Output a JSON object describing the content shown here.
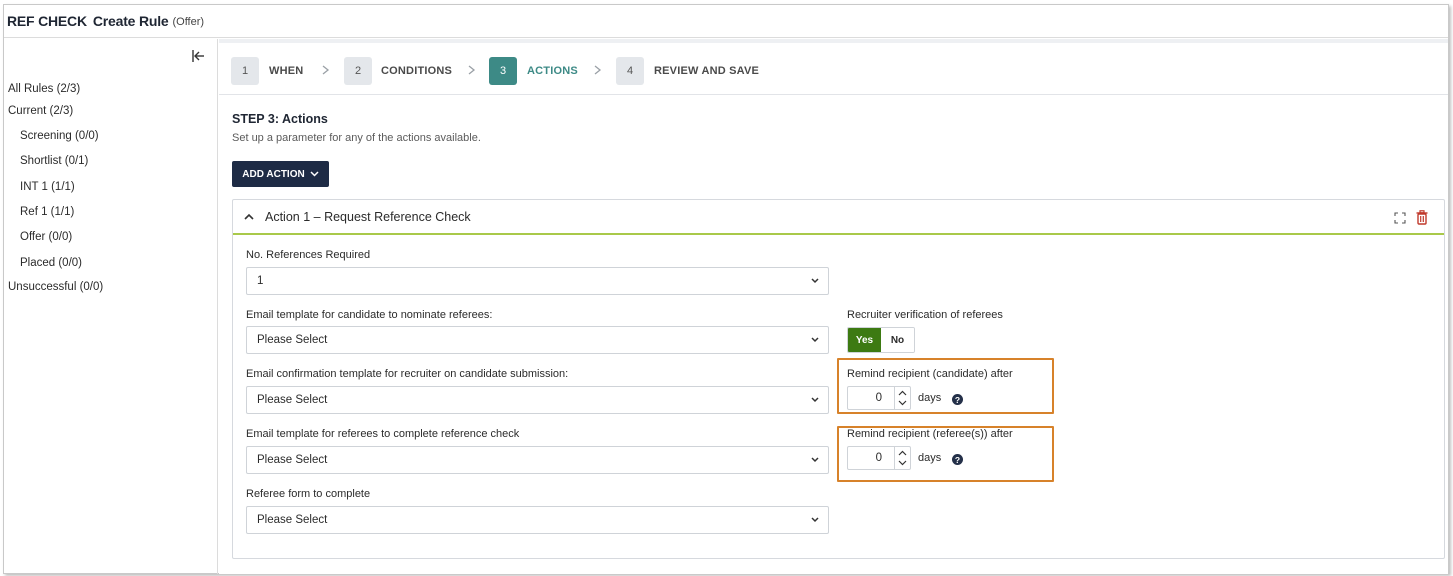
{
  "window": {
    "app_name": "REF CHECK",
    "page_title": "Create Rule",
    "context": "(Offer)"
  },
  "sidebar": {
    "collapse_icon": "collapse-left-icon",
    "items": [
      {
        "label": "All Rules (2/3)"
      },
      {
        "label": "Current (2/3)"
      },
      {
        "label": "Screening (0/0)"
      },
      {
        "label": "Shortlist (0/1)"
      },
      {
        "label": "INT 1 (1/1)"
      },
      {
        "label": "Ref 1 (1/1)"
      },
      {
        "label": "Offer (0/0)"
      },
      {
        "label": "Placed (0/0)"
      },
      {
        "label": "Unsuccessful (0/0)"
      }
    ]
  },
  "steps": [
    {
      "num": "1",
      "label": "WHEN",
      "active": false
    },
    {
      "num": "2",
      "label": "CONDITIONS",
      "active": false
    },
    {
      "num": "3",
      "label": "ACTIONS",
      "active": true
    },
    {
      "num": "4",
      "label": "REVIEW AND SAVE",
      "active": false
    }
  ],
  "step_content": {
    "title": "STEP 3: Actions",
    "subtitle": "Set up a parameter for any of the actions available.",
    "add_action_label": "ADD ACTION"
  },
  "action_card": {
    "title": "Action 1 – Request Reference Check",
    "fields": {
      "num_refs": {
        "label": "No. References Required",
        "value": "1"
      },
      "nominate_template": {
        "label": "Email template for candidate to nominate referees:",
        "value": "Please Select"
      },
      "confirmation_template": {
        "label": "Email confirmation template for recruiter on candidate submission:",
        "value": "Please Select"
      },
      "referee_template": {
        "label": "Email template for referees to complete reference check",
        "value": "Please Select"
      },
      "referee_form": {
        "label": "Referee form to complete",
        "value": "Please Select"
      }
    },
    "verification": {
      "label": "Recruiter verification of referees",
      "yes": "Yes",
      "no": "No",
      "selected": "Yes"
    },
    "remind_candidate": {
      "label": "Remind recipient (candidate) after",
      "value": "0",
      "unit": "days"
    },
    "remind_referee": {
      "label": "Remind recipient (referee(s)) after",
      "value": "0",
      "unit": "days"
    }
  },
  "colors": {
    "step_active": "#3d8a86",
    "yes_active": "#3d7a12",
    "highlight_border": "#d7822a",
    "card_accent": "#a9c94a",
    "primary_button": "#1e2b45",
    "delete_icon": "#c0392b"
  }
}
